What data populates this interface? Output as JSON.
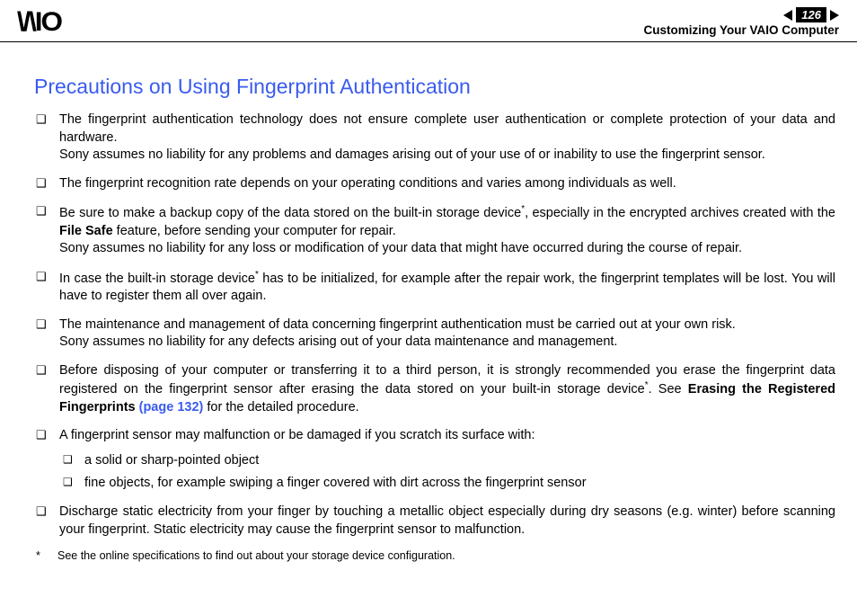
{
  "header": {
    "logo": "\\/\\IO",
    "page_number": "126",
    "section": "Customizing Your VAIO Computer"
  },
  "title": "Precautions on Using Fingerprint Authentication",
  "bullets": {
    "b1a": "The fingerprint authentication technology does not ensure complete user authentication or complete protection of your data and hardware.",
    "b1b": "Sony assumes no liability for any problems and damages arising out of your use of or inability to use the fingerprint sensor.",
    "b2": "The fingerprint recognition rate depends on your operating conditions and varies among individuals as well.",
    "b3a": "Be sure to make a backup copy of the data stored on the built-in storage device",
    "b3b": ", especially in the encrypted archives created with the ",
    "b3bold": "File Safe",
    "b3c": " feature, before sending your computer for repair.",
    "b3d": "Sony assumes no liability for any loss or modification of your data that might have occurred during the course of repair.",
    "b4a": "In case the built-in storage device",
    "b4b": " has to be initialized, for example after the repair work, the fingerprint templates will be lost. You will have to register them all over again.",
    "b5a": "The maintenance and management of data concerning fingerprint authentication must be carried out at your own risk.",
    "b5b": "Sony assumes no liability for any defects arising out of your data maintenance and management.",
    "b6a": "Before disposing of your computer or transferring it to a third person, it is strongly recommended you erase the fingerprint data registered on the fingerprint sensor after erasing the data stored on your built-in storage device",
    "b6b": ". See ",
    "b6bold": "Erasing the Registered Fingerprints ",
    "b6link": "(page 132)",
    "b6c": " for the detailed procedure.",
    "b7": "A fingerprint sensor may malfunction or be damaged if you scratch its surface with:",
    "s1": "a solid or sharp-pointed object",
    "s2": "fine objects, for example swiping a finger covered with dirt across the fingerprint sensor",
    "b8": "Discharge static electricity from your finger by touching a metallic object especially during dry seasons (e.g. winter) before scanning your fingerprint. Static electricity may cause the fingerprint sensor to malfunction."
  },
  "footnote": {
    "star": "*",
    "text": "See the online specifications to find out about your storage device configuration."
  }
}
